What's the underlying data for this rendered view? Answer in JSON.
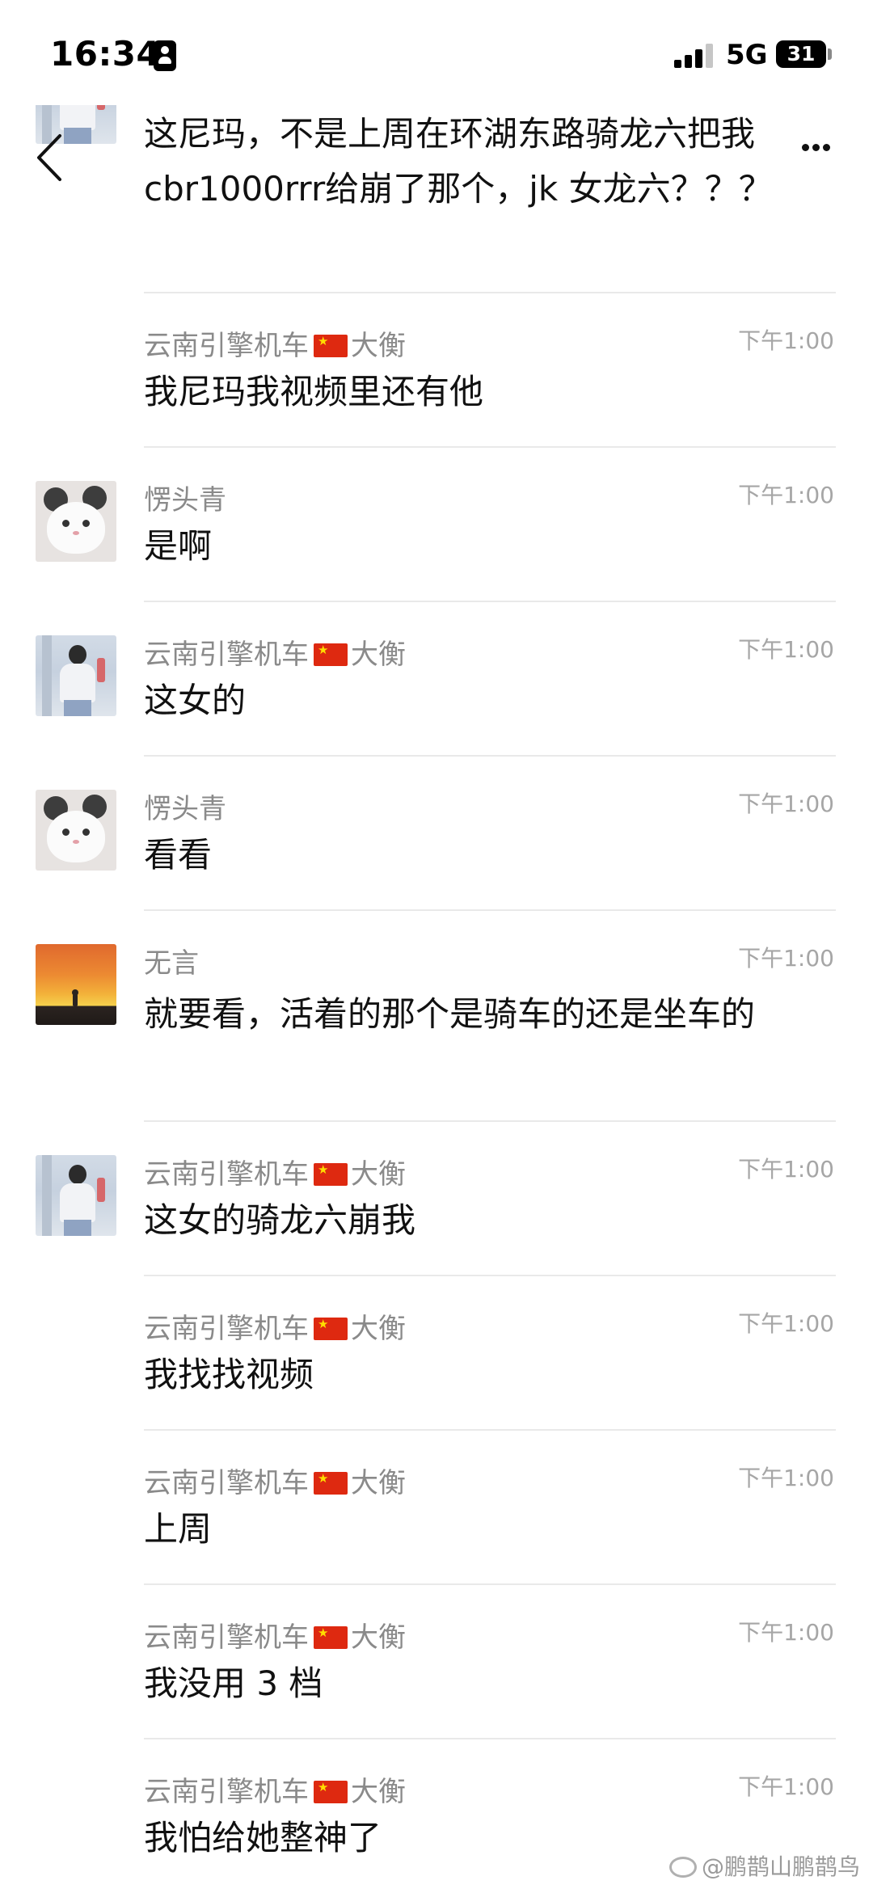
{
  "status_bar": {
    "time": "16:34",
    "network": "5G",
    "battery": "31"
  },
  "chat": {
    "messages": [
      {
        "sender": "",
        "flag": false,
        "time": "",
        "text": "这尼玛，不是上周在环湖东路骑龙六把我 cbr1000rrr给崩了那个，jk 女龙六？？？"
      },
      {
        "sender": "云南引擎机车",
        "suffix": "大衡",
        "flag": true,
        "time": "下午1:00",
        "text": "我尼玛我视频里还有他"
      },
      {
        "sender": "愣头青",
        "suffix": "",
        "flag": false,
        "time": "下午1:00",
        "text": "是啊"
      },
      {
        "sender": "云南引擎机车",
        "suffix": "大衡",
        "flag": true,
        "time": "下午1:00",
        "text": "这女的"
      },
      {
        "sender": "愣头青",
        "suffix": "",
        "flag": false,
        "time": "下午1:00",
        "text": "看看"
      },
      {
        "sender": "无言",
        "suffix": "",
        "flag": false,
        "time": "下午1:00",
        "text": "就要看，活着的那个是骑车的还是坐车的"
      },
      {
        "sender": "云南引擎机车",
        "suffix": "大衡",
        "flag": true,
        "time": "下午1:00",
        "text": "这女的骑龙六崩我"
      },
      {
        "sender": "云南引擎机车",
        "suffix": "大衡",
        "flag": true,
        "time": "下午1:00",
        "text": "我找找视频"
      },
      {
        "sender": "云南引擎机车",
        "suffix": "大衡",
        "flag": true,
        "time": "下午1:00",
        "text": "上周"
      },
      {
        "sender": "云南引擎机车",
        "suffix": "大衡",
        "flag": true,
        "time": "下午1:00",
        "text": "我没用 3 档"
      },
      {
        "sender": "云南引擎机车",
        "suffix": "大衡",
        "flag": true,
        "time": "下午1:00",
        "text": "我怕给她整神了"
      }
    ]
  },
  "watermark": "@鹏鹊山鹏鹊鸟",
  "icons": {
    "back": "back-icon",
    "more": "more-icon",
    "flag": "cn-flag-icon"
  }
}
